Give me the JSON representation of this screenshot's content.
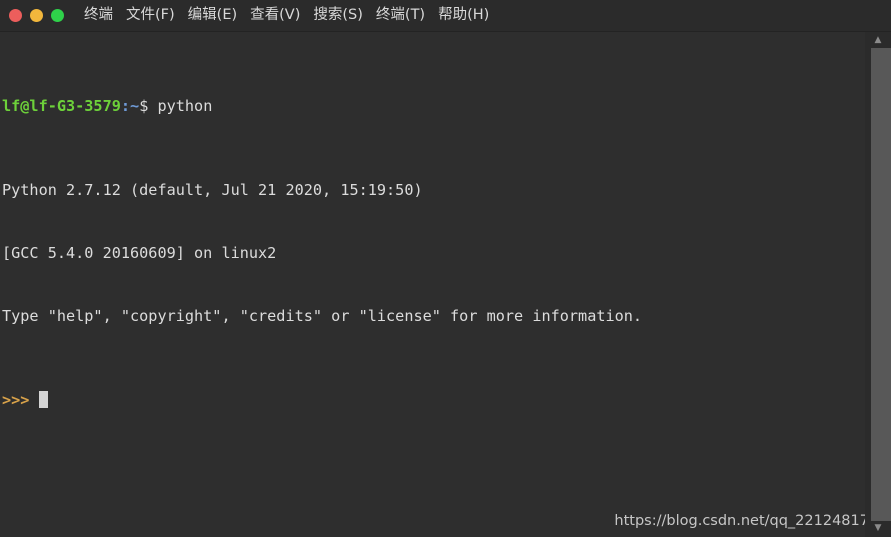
{
  "window": {
    "title": "Terminal",
    "controls": [
      {
        "name": "close",
        "color": "#ec5e5c"
      },
      {
        "name": "minimize",
        "color": "#f2b73c"
      },
      {
        "name": "maximize",
        "color": "#2fd14a"
      }
    ]
  },
  "menubar": {
    "items": [
      {
        "label": "终端"
      },
      {
        "label": "文件(F)"
      },
      {
        "label": "编辑(E)"
      },
      {
        "label": "查看(V)"
      },
      {
        "label": "搜索(S)"
      },
      {
        "label": "终端(T)"
      },
      {
        "label": "帮助(H)"
      }
    ]
  },
  "terminal": {
    "prompt": {
      "user_host": "lf@lf-G3-3579",
      "separator": ":",
      "path": "~",
      "sigil": "$",
      "command": " python"
    },
    "output": [
      "Python 2.7.12 (default, Jul 21 2020, 15:19:50)",
      "[GCC 5.4.0 20160609] on linux2",
      "Type \"help\", \"copyright\", \"credits\" or \"license\" for more information."
    ],
    "python_prompt": ">>>",
    "cursor": "block",
    "colors": {
      "background": "#2e2e2e",
      "foreground": "#d6d6d6",
      "green": "#6dd13a",
      "blue": "#6f9ad6",
      "prompt_orange": "#d8a24a",
      "cursor": "#d4d4d4"
    }
  },
  "scrollbar": {
    "up_arrow": "▲",
    "down_arrow": "▼"
  },
  "watermark": {
    "text": "https://blog.csdn.net/qq_22124817"
  }
}
